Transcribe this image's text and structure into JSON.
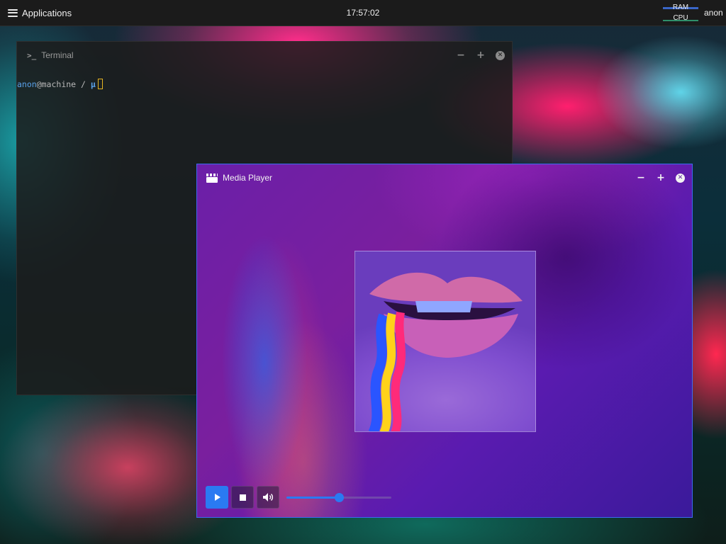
{
  "panel": {
    "applications_label": "Applications",
    "clock": "17:57:02",
    "ram_label": "RAM",
    "cpu_label": "CPU",
    "user": "anon"
  },
  "terminal": {
    "title": "Terminal",
    "icon": ">_",
    "prompt": {
      "user": "anon",
      "host": "@machine",
      "path": " / ",
      "symbol": "µ"
    },
    "controls": {
      "minimize": "−",
      "maximize": "+",
      "close": "✕"
    }
  },
  "media_player": {
    "title": "Media Player",
    "controls": {
      "minimize": "−",
      "maximize": "+",
      "close": "✕"
    },
    "volume_level": 0.5
  },
  "icons": {
    "menu": "hamburger-icon",
    "terminal": "terminal-icon",
    "media": "clapperboard-icon",
    "play": "play-icon",
    "stop": "stop-icon",
    "volume": "speaker-icon"
  },
  "colors": {
    "accent": "#2a7af2",
    "terminal_prompt_user": "#5aa2ea",
    "cursor_outline": "#e6b422",
    "media_border": "#3b6cf0"
  }
}
